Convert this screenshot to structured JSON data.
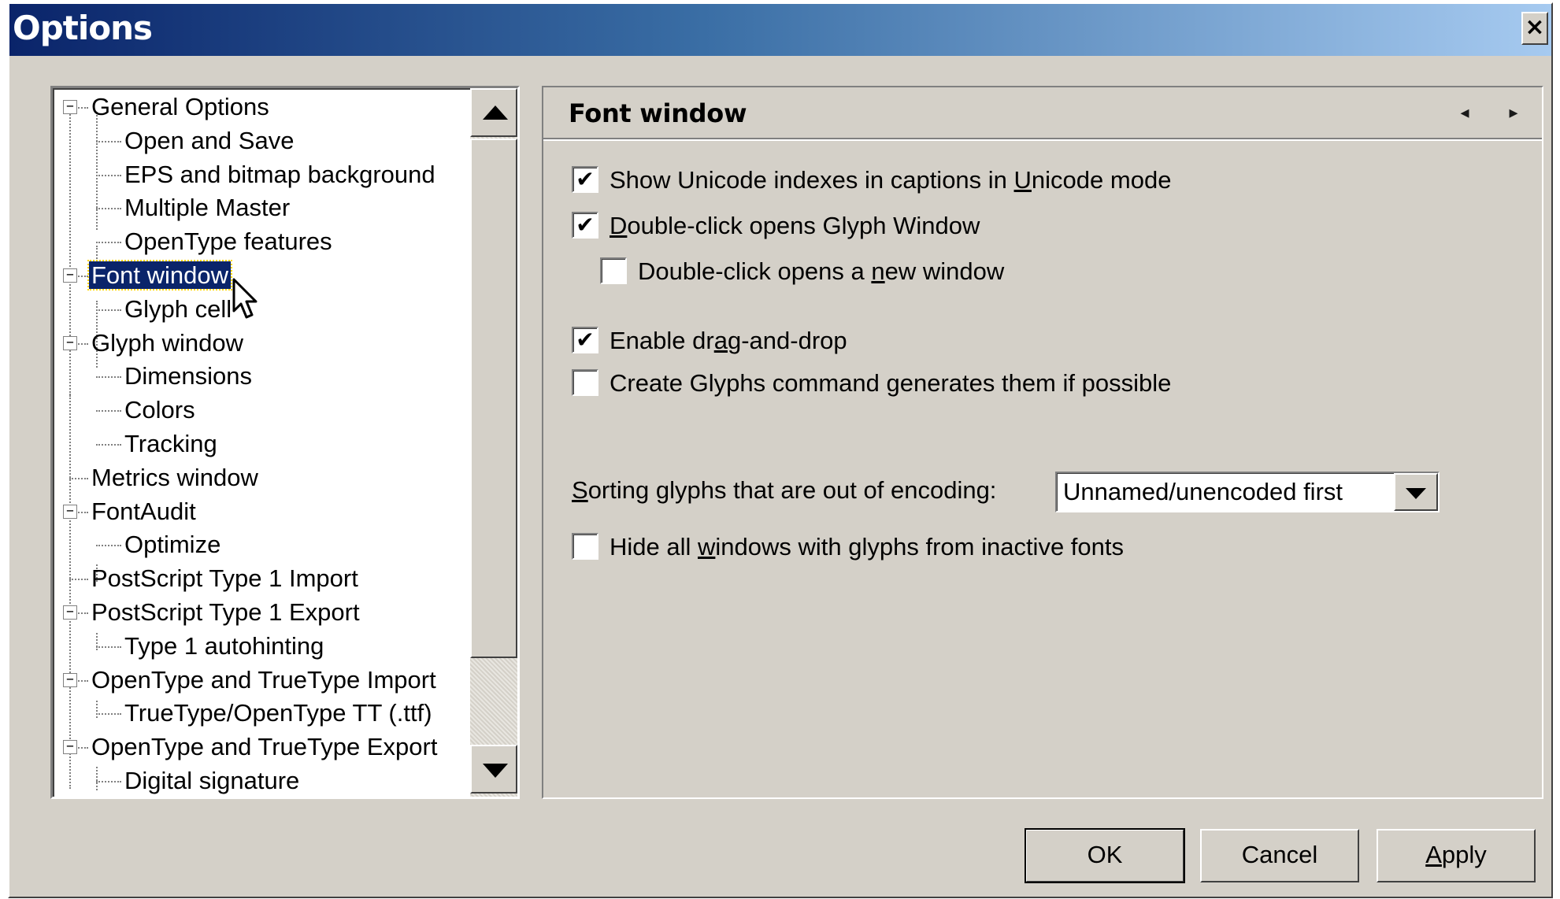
{
  "window": {
    "title": "Options",
    "close_label": "×"
  },
  "tree": {
    "items": [
      {
        "label": "General Options",
        "level": 0,
        "expander": "−"
      },
      {
        "label": "Open and Save",
        "level": 1
      },
      {
        "label": "EPS and bitmap background",
        "level": 1
      },
      {
        "label": "Multiple Master",
        "level": 1
      },
      {
        "label": "OpenType features",
        "level": 1
      },
      {
        "label": "Font window",
        "level": 0,
        "expander": "−",
        "selected": true
      },
      {
        "label": "Glyph cell",
        "level": 1
      },
      {
        "label": "Glyph window",
        "level": 0,
        "expander": "−"
      },
      {
        "label": "Dimensions",
        "level": 1
      },
      {
        "label": "Colors",
        "level": 1
      },
      {
        "label": "Tracking",
        "level": 1
      },
      {
        "label": "Metrics window",
        "level": 0
      },
      {
        "label": "FontAudit",
        "level": 0,
        "expander": "−"
      },
      {
        "label": "Optimize",
        "level": 1
      },
      {
        "label": "PostScript Type 1 Import",
        "level": 0
      },
      {
        "label": "PostScript Type 1 Export",
        "level": 0,
        "expander": "−"
      },
      {
        "label": "Type 1 autohinting",
        "level": 1
      },
      {
        "label": "OpenType and TrueType Import",
        "level": 0,
        "expander": "−"
      },
      {
        "label": "TrueType/OpenType TT (.ttf)",
        "level": 1
      },
      {
        "label": "OpenType and TrueType Export",
        "level": 0,
        "expander": "−"
      },
      {
        "label": "Digital signature",
        "level": 1
      }
    ]
  },
  "panel": {
    "title": "Font window",
    "prev_glyph": "◂",
    "next_glyph": "▸",
    "options": {
      "show_unicode": {
        "checked": true,
        "mark": "✔",
        "before": "Show Unicode indexes in captions in ",
        "underlined": "U",
        "after": "nicode mode"
      },
      "double_click_opens": {
        "checked": true,
        "mark": "✔",
        "before": "",
        "underlined": "D",
        "after": "ouble-click opens Glyph Window"
      },
      "double_click_new": {
        "checked": false,
        "mark": "",
        "before": "Double-click opens a ",
        "underlined": "n",
        "after": "ew  window"
      },
      "drag_drop": {
        "checked": true,
        "mark": "✔",
        "before": "Enable dr",
        "underlined": "a",
        "after": "g-and-drop"
      },
      "create_glyphs": {
        "checked": false,
        "mark": "",
        "before": "Create Glyphs command generates them if possible",
        "underlined": "",
        "after": ""
      },
      "hide_windows": {
        "checked": false,
        "mark": "",
        "before": "Hide all ",
        "underlined": "w",
        "after": "indows with glyphs from inactive fonts"
      }
    },
    "sorting": {
      "label_underlined": "S",
      "label_rest": "orting glyphs that are out of encoding:",
      "selected": "Unnamed/unencoded first"
    }
  },
  "buttons": {
    "ok": "OK",
    "cancel": "Cancel",
    "apply_underlined": "A",
    "apply_rest": "pply"
  }
}
